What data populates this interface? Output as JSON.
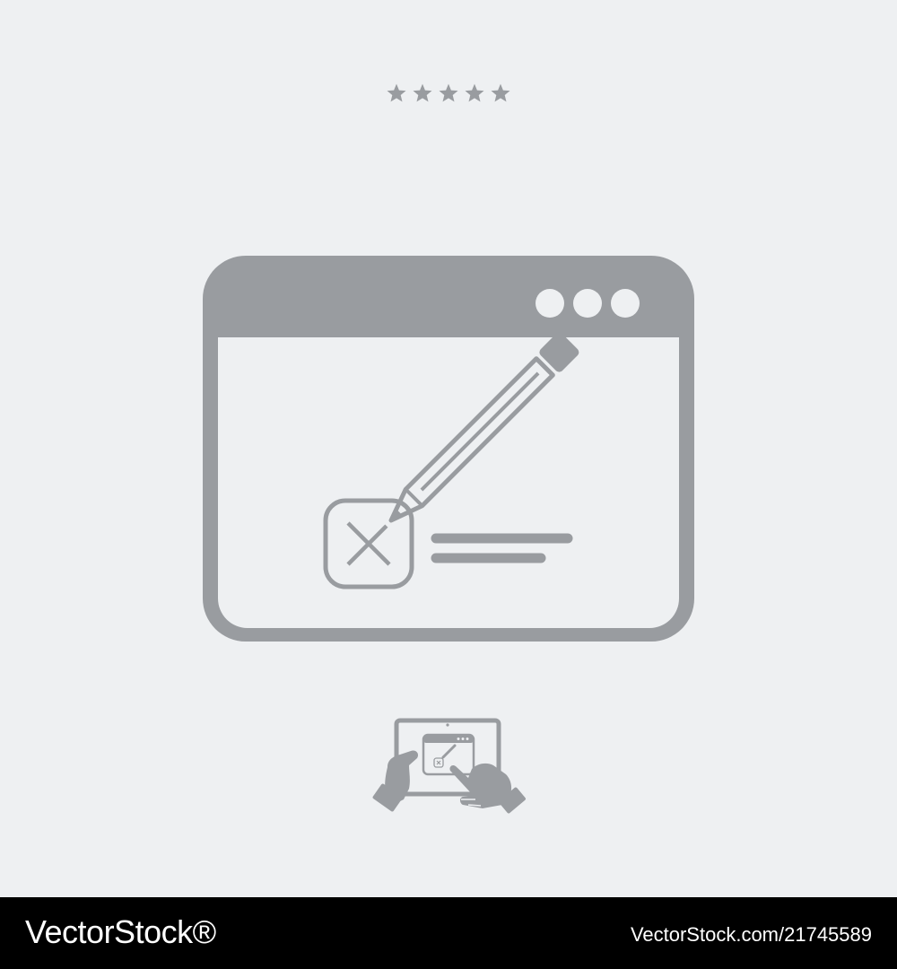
{
  "colors": {
    "background": "#eef0f2",
    "icon": "#999ca0",
    "footer_bg": "#000000",
    "footer_text": "#ffffff"
  },
  "rating": {
    "stars": 5,
    "icon": "star-icon"
  },
  "main_icon": {
    "name": "browser-window-edit-icon",
    "parts": [
      "window-dots-icon",
      "pencil-icon",
      "x-checkbox-icon",
      "text-lines-icon"
    ]
  },
  "small_icon": {
    "name": "tablet-hands-icon"
  },
  "footer": {
    "brand": "VectorStock®",
    "credit": "VectorStock.com/21745589"
  }
}
